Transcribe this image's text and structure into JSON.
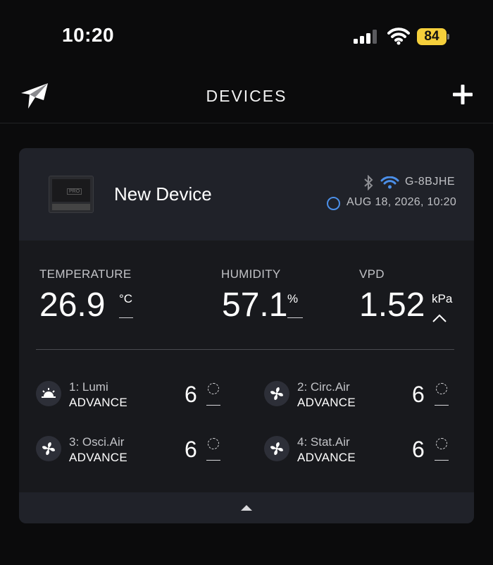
{
  "status_bar": {
    "time": "10:20",
    "battery": "84",
    "battery_color": "#f5cf3b",
    "icons": [
      "signal-icon",
      "wifi-icon",
      "battery-icon"
    ]
  },
  "nav": {
    "title": "DEVICES",
    "left_icon": "paper-plane-logo-icon",
    "right_icon": "plus-icon"
  },
  "device": {
    "name": "New Device",
    "id": "G-8BJHE",
    "timestamp": "AUG 18, 2026, 10:20",
    "connection_icons": [
      "bluetooth-icon",
      "wifi-icon",
      "clock-icon"
    ],
    "accent_color": "#4b8fe8",
    "thumbnail_label": "PRO",
    "metrics": [
      {
        "label": "TEMPERATURE",
        "value": "26.9",
        "unit": "°C",
        "indicator": "dash"
      },
      {
        "label": "HUMIDITY",
        "value": "57.1",
        "unit": "%",
        "indicator": "dash"
      },
      {
        "label": "VPD",
        "value": "1.52",
        "unit": "kPa",
        "indicator": "chevron-up"
      }
    ],
    "ports": [
      {
        "name": "1: Lumi",
        "mode": "ADVANCE",
        "value": "6",
        "icon": "sunrise-icon"
      },
      {
        "name": "2: Circ.Air",
        "mode": "ADVANCE",
        "value": "6",
        "icon": "fan-icon"
      },
      {
        "name": "3: Osci.Air",
        "mode": "ADVANCE",
        "value": "6",
        "icon": "fan-icon"
      },
      {
        "name": "4: Stat.Air",
        "mode": "ADVANCE",
        "value": "6",
        "icon": "fan-icon"
      }
    ],
    "footer_icon": "collapse-up-icon"
  }
}
